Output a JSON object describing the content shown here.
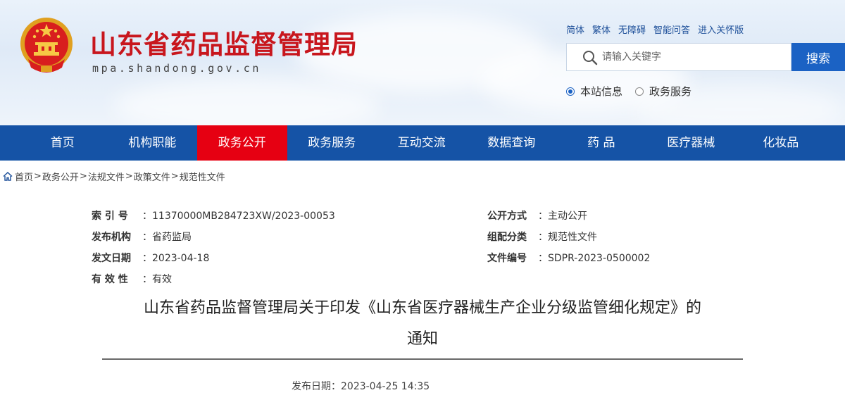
{
  "header": {
    "site_title": "山东省药品监督管理局",
    "domain": "mpa.shandong.gov.cn",
    "top_links": [
      "简体",
      "繁体",
      "无障碍",
      "智能问答",
      "进入关怀版"
    ],
    "search": {
      "placeholder": "请输入关键字",
      "button_label": "搜索"
    },
    "radio_options": [
      {
        "label": "本站信息",
        "selected": true
      },
      {
        "label": "政务服务",
        "selected": false
      }
    ]
  },
  "nav": {
    "items": [
      "首页",
      "机构职能",
      "政务公开",
      "政务服务",
      "互动交流",
      "数据查询",
      "药 品",
      "医疗器械",
      "化妆品"
    ],
    "active": "政务公开",
    "active_color": "#e60012",
    "bar_color": "#1553a6"
  },
  "breadcrumb": {
    "items": [
      "首页",
      "政务公开",
      "法规文件",
      "政策文件",
      "规范性文件"
    ],
    "separator": ">"
  },
  "meta": {
    "index_no": {
      "label": "索 引 号",
      "value": "11370000MB284723XW/2023-00053"
    },
    "issuer": {
      "label": "发布机构",
      "value": "省药监局"
    },
    "issue_date": {
      "label": "发文日期",
      "value": "2023-04-18"
    },
    "validity": {
      "label": "有 效 性",
      "value": "有效"
    },
    "disclosure": {
      "label": "公开方式",
      "value": "主动公开"
    },
    "category": {
      "label": "组配分类",
      "value": "规范性文件"
    },
    "doc_no": {
      "label": "文件编号",
      "value": "SDPR-2023-0500002"
    },
    "colon": "："
  },
  "document": {
    "title_line1": "山东省药品监督管理局关于印发《山东省医疗器械生产企业分级监管细化规定》的",
    "title_line2": "通知",
    "publish_label": "发布日期：",
    "publish_datetime": "2023-04-25 14:35"
  }
}
